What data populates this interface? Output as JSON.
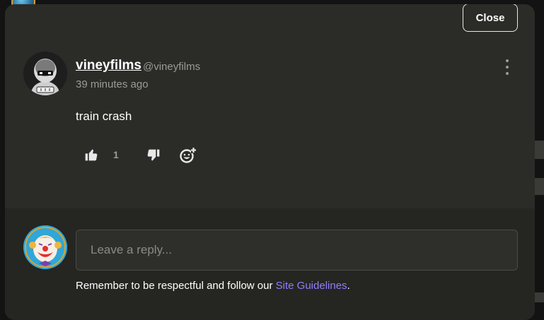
{
  "modal": {
    "close_label": "Close"
  },
  "comment": {
    "author_name": "vineyfilms",
    "author_handle": "@vineyfilms",
    "timestamp": "39 minutes ago",
    "text": "train crash",
    "like_count": "1"
  },
  "reply": {
    "placeholder": "Leave a reply...",
    "notice_prefix": "Remember to be respectful and follow our ",
    "notice_link": "Site Guidelines",
    "notice_suffix": "."
  },
  "colors": {
    "modal_bg": "#2b2b28",
    "link": "#8f7dff",
    "muted_text": "#9a9a96"
  }
}
